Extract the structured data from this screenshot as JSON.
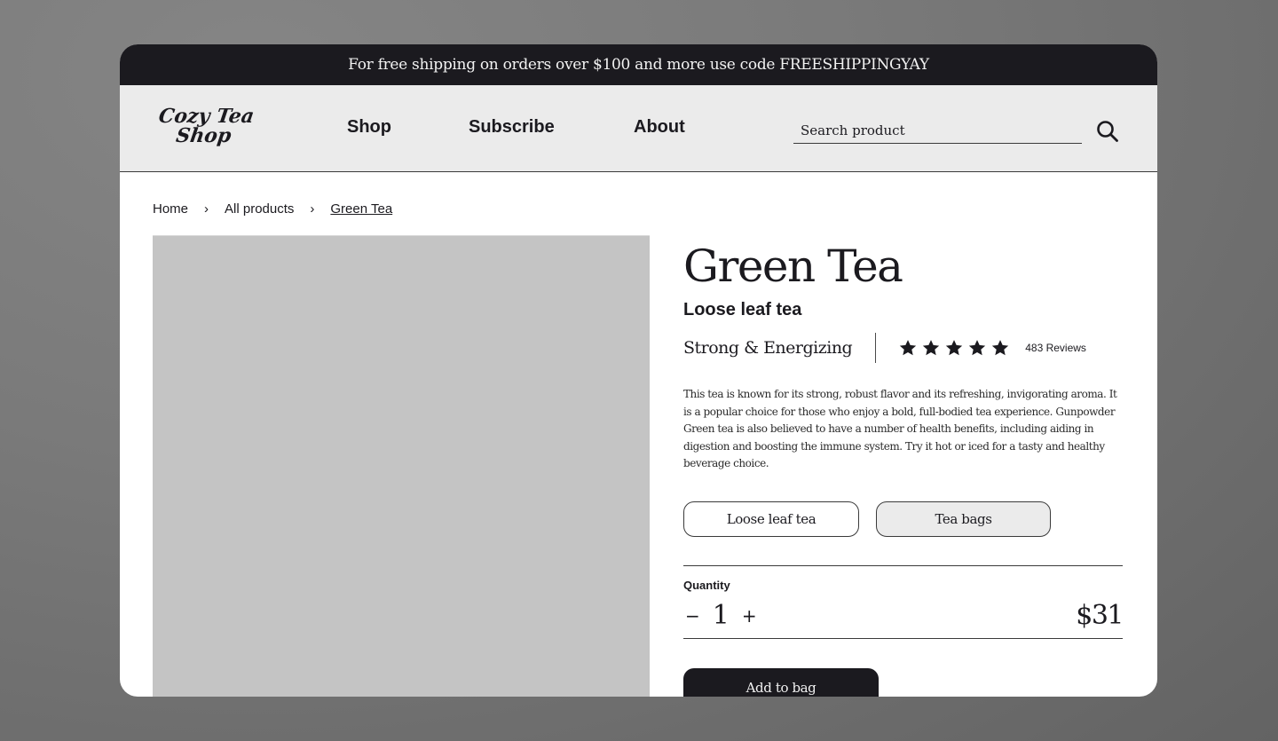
{
  "promo": {
    "text": "For free shipping on orders over $100 and more use code FREESHIPPINGYAY"
  },
  "header": {
    "logo_line1": "Cozy Tea",
    "logo_line2": "Shop",
    "nav": [
      {
        "label": "Shop"
      },
      {
        "label": "Subscribe"
      },
      {
        "label": "About"
      }
    ],
    "search": {
      "placeholder": "Search product",
      "value": "",
      "icon": "search-icon"
    }
  },
  "breadcrumb": {
    "items": [
      "Home",
      "All products",
      "Green Tea"
    ],
    "separator": "›"
  },
  "product": {
    "title": "Green Tea",
    "type": "Loose leaf tea",
    "tagline": "Strong & Energizing",
    "rating": {
      "stars": 5,
      "max": 5,
      "reviews_label": "483 Reviews"
    },
    "description": "This tea is known for its strong, robust flavor and its refreshing, invigorating aroma. It is a popular choice for those who enjoy a bold, full-bodied tea experience. Gunpowder Green tea is also believed to have a number of health benefits, including aiding in digestion and boosting the immune system. Try it hot or iced for a tasty and healthy beverage choice.",
    "options": [
      {
        "label": "Loose leaf tea",
        "selected": false
      },
      {
        "label": "Tea bags",
        "selected": true
      }
    ],
    "quantity": {
      "label": "Quantity",
      "value": "1",
      "decrement": "−",
      "increment": "+"
    },
    "price": "$31",
    "add_to_bag_label": "Add to bag"
  },
  "colors": {
    "dark": "#1b1a1f",
    "nav_bg": "#ebebeb",
    "image_placeholder": "#c4c4c4",
    "page_bg": "#7a7a7a"
  }
}
